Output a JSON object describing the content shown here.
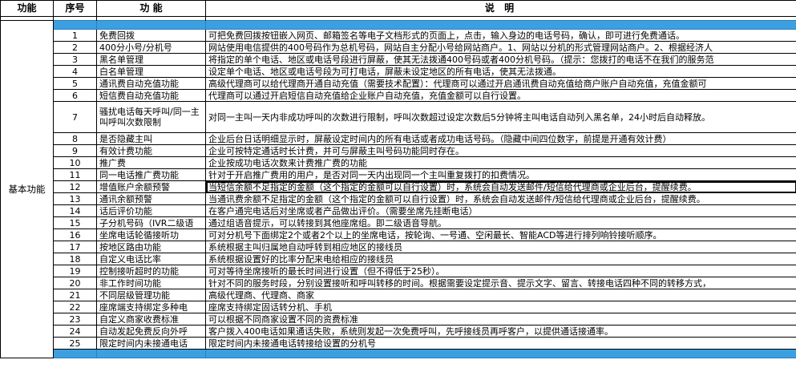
{
  "header": {
    "category": "功能",
    "index": "序号",
    "function": "功  能",
    "description": "说    明"
  },
  "category_label": "基本功能",
  "rows": [
    {
      "n": "1",
      "f": "免费回拨",
      "d": "可把免费回拨按钮嵌入网页、邮箱签名等电子文档形式的页面上，点击，输入身边的电话号码，确认，即可进行免费通话。"
    },
    {
      "n": "2",
      "f": "400分小号/分机号",
      "d": "网站使用电信提供的400号码作为总机号码，网站自主分配小号给网站商户。1、网站以分机的形式管理网站商户。2、根据经济人"
    },
    {
      "n": "3",
      "f": "黑名单管理",
      "d": "将指定的单个电话、地区或电话号段进行屏蔽，使其无法拨通400号码或者400分机号码。（提示：您拨打的电话不在我们的服务范"
    },
    {
      "n": "4",
      "f": "白名单管理",
      "d": "设定单个电话、地区或电话号段为可打电话，屏蔽未设定地区的所有电话，使其无法拨通。"
    },
    {
      "n": "5",
      "f": "通讯费自动充值功能",
      "d": "高级代理商可以给代理商开通自动充值（需要技术配置）：代理商可以通过开启通讯费自动充值给商户账户自动充值，充值金额可"
    },
    {
      "n": "6",
      "f": "短信费自动充值功能",
      "d": "代理商可以通过开启短信自动充值给企业账户自动充值，充值金额可以自行设置。"
    },
    {
      "n": "7",
      "f": "骚扰电话每天呼叫/同一主叫呼叫次数限制",
      "d": "对同一主叫一天内非成功呼叫的次数进行限制，呼叫次数超过设定次数后5分钟将主叫电话自动列入黑名单，24小时后自动释放。"
    },
    {
      "n": "8",
      "f": "是否隐藏主叫",
      "d": "企业后台日话明细显示时，屏蔽设定时间内的所有电话或者成功电话号码。（隐藏中间四位数字，前提是开通有效计费）"
    },
    {
      "n": "9",
      "f": "有效计费功能",
      "d": "企业可按特定通话时长计费，并可与屏蔽主叫号码功能同时存在。"
    },
    {
      "n": "10",
      "f": "推广费",
      "d": "企业按成功电话次数来计费推广费的功能"
    },
    {
      "n": "11",
      "f": "同一电话推广费功能",
      "d": "针对于开启推广费用的用户，是否对同一天内出现同一个主叫重复拨打的扣费情况。"
    },
    {
      "n": "12",
      "f": "增值账户余额预警",
      "d": "当短信余额不足指定的金额（这个指定的金额可以自行设置）时，系统会自动发送邮件/短信给代理商或企业后台，提醒续费。"
    },
    {
      "n": "13",
      "f": "通讯余额预警",
      "d": "当通讯费余额不足指定的金额（这个指定的金额可以自行设置）时，系统会自动发送邮件/短信给代理商或企业后台，提醒续费。"
    },
    {
      "n": "14",
      "f": "话后评价功能",
      "d": "在客户通完电话后对坐席或者产品做出评价。（需要坐席先挂断电话）"
    },
    {
      "n": "15",
      "f": "子分机号码（IVR二级语",
      "d": "通过组语音提示，可以转接到其他座席组。即二级语音导航。"
    },
    {
      "n": "16",
      "f": "坐席电话轮循接听功",
      "d": "可对分机号下面绑定2个或者2个以上的坐席电话，按轮询、一号通、空闲最长、智能ACD等进行排列响铃接听顺序。"
    },
    {
      "n": "17",
      "f": "按地区路由功能",
      "d": "系统根据主叫归属地自动呼转到相应地区的接线员"
    },
    {
      "n": "18",
      "f": "自定义电话比率",
      "d": "系统根据设置好的比率分配来电给相应的接线员"
    },
    {
      "n": "19",
      "f": "控制接听超时的功能",
      "d": "可对等待坐席接听的最长时间进行设置（但不得低于25秒）。"
    },
    {
      "n": "20",
      "f": "非工作时间功能",
      "d": "针对不同的服务时段，分别设置接听和呼叫转移的时间。根据需要设定提示音、提示文字、留言、转接电话四种不同的转移方式，"
    },
    {
      "n": "21",
      "f": "不同层级管理功能",
      "d": "高级代理商、代理商、商家"
    },
    {
      "n": "22",
      "f": "座席端支持绑定多种电",
      "d": "座席支持绑定固话转分机、手机"
    },
    {
      "n": "23",
      "f": "自定义商家收费标准",
      "d": "可以根据不同商家设置不同的资费标准"
    },
    {
      "n": "24",
      "f": "自动发起免费反向外呼",
      "d": "客户拨入400电话如果通话失败，系统则发起一次免费呼叫，先呼接线员再呼客户，以提供通话接通率。"
    },
    {
      "n": "25",
      "f": "限定时间内未接通电话",
      "d": "限定时间内未接通电话转接给设置的分机号"
    }
  ]
}
